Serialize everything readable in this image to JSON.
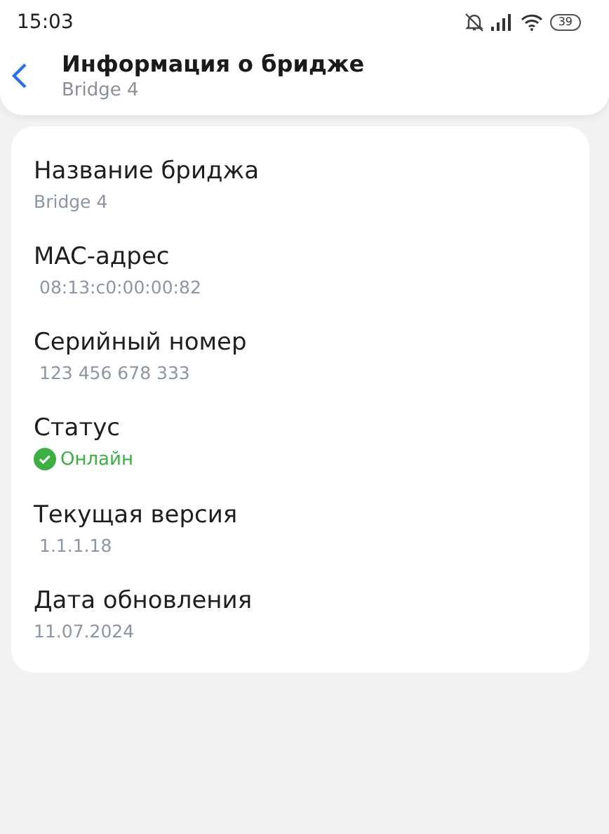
{
  "status_bar": {
    "time": "15:03",
    "battery": "39"
  },
  "header": {
    "title": "Информация о бридже",
    "subtitle": "Bridge 4"
  },
  "fields": [
    {
      "kind": "text",
      "label": "Название бриджа",
      "value": "Bridge 4"
    },
    {
      "kind": "text",
      "label": "MAC-адрес",
      "value": "08:13:c0:00:00:82"
    },
    {
      "kind": "text",
      "label": "Серийный номер",
      "value": "123 456 678 333"
    },
    {
      "kind": "status",
      "label": "Статус",
      "value": "Онлайн"
    },
    {
      "kind": "text",
      "label": "Текущая версия",
      "value": "1.1.1.18"
    },
    {
      "kind": "text",
      "label": "Дата обновления",
      "value": "11.07.2024"
    }
  ]
}
